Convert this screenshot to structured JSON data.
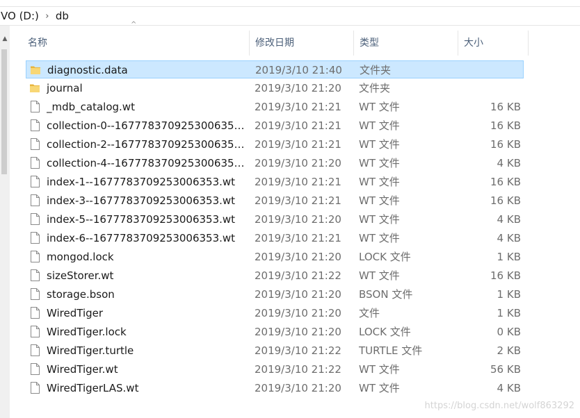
{
  "address": {
    "crumbs": [
      "VO (D:)",
      "db"
    ],
    "separator": "›"
  },
  "columns": {
    "name": "名称",
    "date": "修改日期",
    "type": "类型",
    "size": "大小"
  },
  "files": [
    {
      "name": "diagnostic.data",
      "date": "2019/3/10 21:40",
      "type": "文件夹",
      "size": "",
      "icon": "folder-icon",
      "selected": true
    },
    {
      "name": "journal",
      "date": "2019/3/10 21:20",
      "type": "文件夹",
      "size": "",
      "icon": "folder-icon"
    },
    {
      "name": "_mdb_catalog.wt",
      "date": "2019/3/10 21:21",
      "type": "WT 文件",
      "size": "16 KB",
      "icon": "file-icon"
    },
    {
      "name": "collection-0--1677783709253006353...",
      "date": "2019/3/10 21:21",
      "type": "WT 文件",
      "size": "16 KB",
      "icon": "file-icon"
    },
    {
      "name": "collection-2--1677783709253006353...",
      "date": "2019/3/10 21:21",
      "type": "WT 文件",
      "size": "16 KB",
      "icon": "file-icon"
    },
    {
      "name": "collection-4--1677783709253006353...",
      "date": "2019/3/10 21:20",
      "type": "WT 文件",
      "size": "4 KB",
      "icon": "file-icon"
    },
    {
      "name": "index-1--1677783709253006353.wt",
      "date": "2019/3/10 21:21",
      "type": "WT 文件",
      "size": "16 KB",
      "icon": "file-icon"
    },
    {
      "name": "index-3--1677783709253006353.wt",
      "date": "2019/3/10 21:21",
      "type": "WT 文件",
      "size": "16 KB",
      "icon": "file-icon"
    },
    {
      "name": "index-5--1677783709253006353.wt",
      "date": "2019/3/10 21:20",
      "type": "WT 文件",
      "size": "4 KB",
      "icon": "file-icon"
    },
    {
      "name": "index-6--1677783709253006353.wt",
      "date": "2019/3/10 21:21",
      "type": "WT 文件",
      "size": "4 KB",
      "icon": "file-icon"
    },
    {
      "name": "mongod.lock",
      "date": "2019/3/10 21:20",
      "type": "LOCK 文件",
      "size": "1 KB",
      "icon": "file-icon"
    },
    {
      "name": "sizeStorer.wt",
      "date": "2019/3/10 21:22",
      "type": "WT 文件",
      "size": "16 KB",
      "icon": "file-icon"
    },
    {
      "name": "storage.bson",
      "date": "2019/3/10 21:20",
      "type": "BSON 文件",
      "size": "1 KB",
      "icon": "file-icon"
    },
    {
      "name": "WiredTiger",
      "date": "2019/3/10 21:20",
      "type": "文件",
      "size": "1 KB",
      "icon": "file-icon"
    },
    {
      "name": "WiredTiger.lock",
      "date": "2019/3/10 21:20",
      "type": "LOCK 文件",
      "size": "0 KB",
      "icon": "file-icon"
    },
    {
      "name": "WiredTiger.turtle",
      "date": "2019/3/10 21:22",
      "type": "TURTLE 文件",
      "size": "2 KB",
      "icon": "file-icon"
    },
    {
      "name": "WiredTiger.wt",
      "date": "2019/3/10 21:22",
      "type": "WT 文件",
      "size": "56 KB",
      "icon": "file-icon"
    },
    {
      "name": "WiredTigerLAS.wt",
      "date": "2019/3/10 21:20",
      "type": "WT 文件",
      "size": "4 KB",
      "icon": "file-icon"
    }
  ],
  "watermark": "https://blog.csdn.net/wolf863292",
  "colors": {
    "selection_bg": "#cce8ff",
    "selection_border": "#99d1ff",
    "folder": "#f8d775",
    "header_text": "#4c607a"
  }
}
